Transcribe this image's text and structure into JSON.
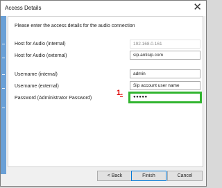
{
  "window": {
    "title": "Access Details",
    "close_glyph": "✕"
  },
  "intro": "Please enter the access details for the audio connection",
  "fields": [
    {
      "label": "Host for Audio (internal)",
      "value": "192.168.0.161"
    },
    {
      "label": "Host for Audio (external)",
      "value": "sip.antisip.com"
    },
    {
      "label": "Username (internal)",
      "value": "admin"
    },
    {
      "label": "Username (external)",
      "value": "Sip account user name"
    },
    {
      "label": "Password (Administrator Password)",
      "value": "●●●●●"
    }
  ],
  "annotation": {
    "step": "1.",
    "color": "#e00000",
    "highlight_color": "#31b52f"
  },
  "buttons": {
    "back": "< Back",
    "finish": "Finish",
    "cancel": "Cancel"
  }
}
